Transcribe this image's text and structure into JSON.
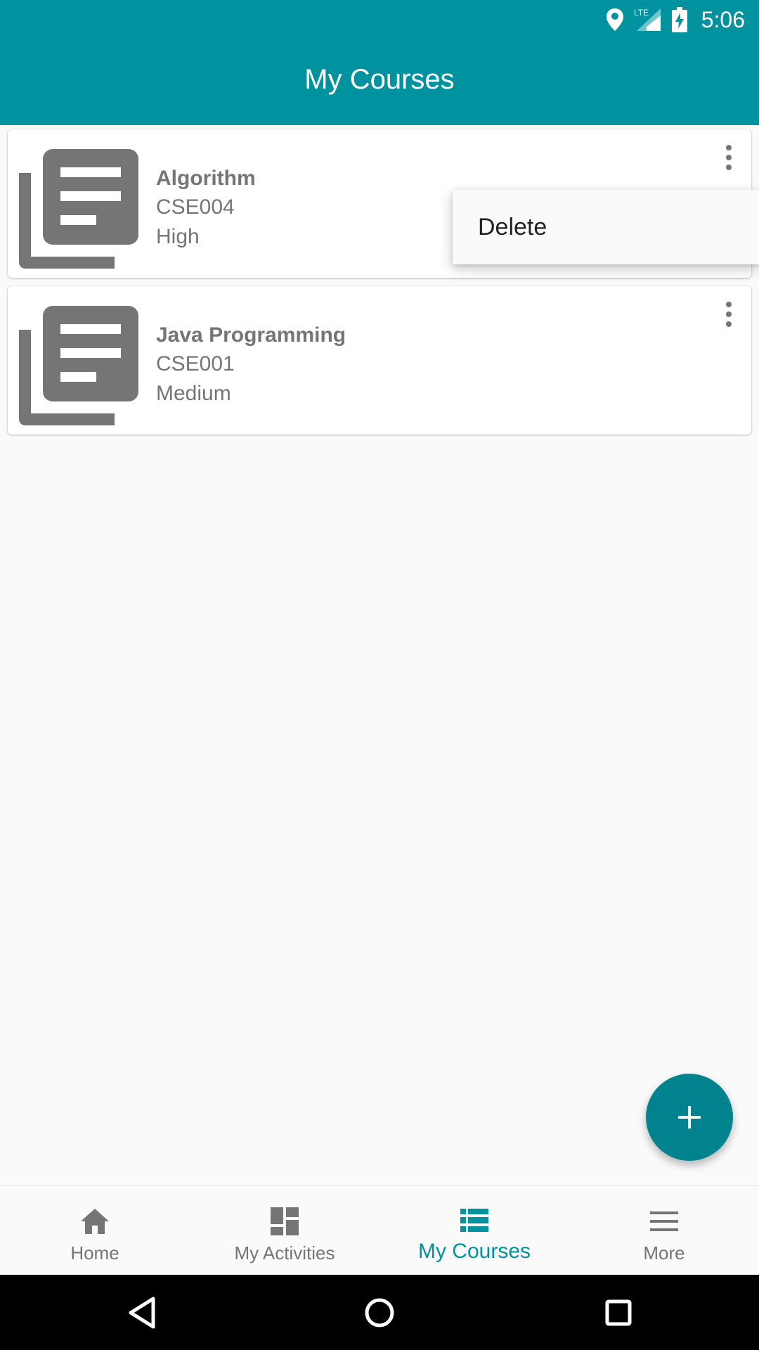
{
  "status_bar": {
    "time": "5:06",
    "network": "LTE",
    "icons": [
      "location-icon",
      "signal-icon",
      "battery-charging-icon"
    ]
  },
  "app_bar": {
    "title": "My Courses"
  },
  "courses": [
    {
      "name": "Algorithm",
      "code": "CSE004",
      "priority": "High"
    },
    {
      "name": "Java Programming",
      "code": "CSE001",
      "priority": "Medium"
    }
  ],
  "popup_menu": {
    "items": [
      "Delete"
    ]
  },
  "fab": {
    "icon": "plus-icon"
  },
  "bottom_nav": {
    "items": [
      {
        "label": "Home",
        "icon": "home-icon"
      },
      {
        "label": "My Activities",
        "icon": "dashboard-icon"
      },
      {
        "label": "My Courses",
        "icon": "list-icon",
        "active": true
      },
      {
        "label": "More",
        "icon": "menu-icon"
      }
    ]
  },
  "colors": {
    "primary": "#00929f",
    "fab": "#00838f",
    "text_secondary": "#757575",
    "icon_gray": "#757575"
  }
}
